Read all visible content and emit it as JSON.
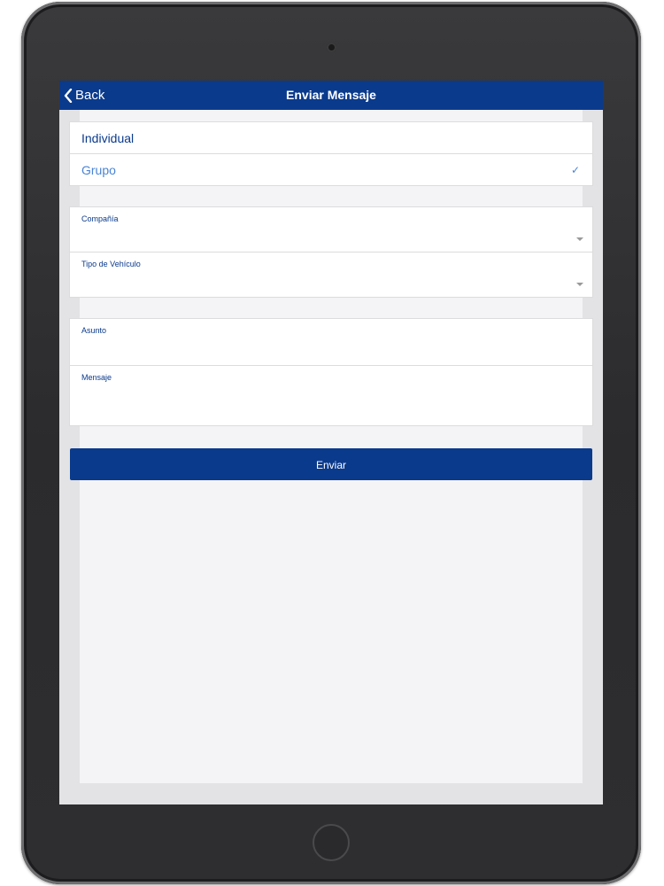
{
  "navbar": {
    "back_label": "Back",
    "title": "Enviar Mensaje"
  },
  "recipient_type": {
    "options": [
      {
        "label": "Individual",
        "selected": false
      },
      {
        "label": "Grupo",
        "selected": true
      }
    ],
    "check_glyph": "✓"
  },
  "filters": {
    "company_label": "Compañía",
    "company_value": "",
    "vehicle_type_label": "Tipo de Vehículo",
    "vehicle_type_value": ""
  },
  "message": {
    "subject_label": "Asunto",
    "subject_value": "",
    "body_label": "Mensaje",
    "body_value": ""
  },
  "send_button_label": "Enviar",
  "colors": {
    "navbar": "#0a3a8c",
    "primary_text": "#0a3a8c",
    "selected_option": "#4a84d4",
    "background": "#f4f4f6"
  },
  "icons": {
    "back": "chevron-left-icon",
    "check": "checkmark-icon",
    "dropdown": "caret-down-icon"
  }
}
